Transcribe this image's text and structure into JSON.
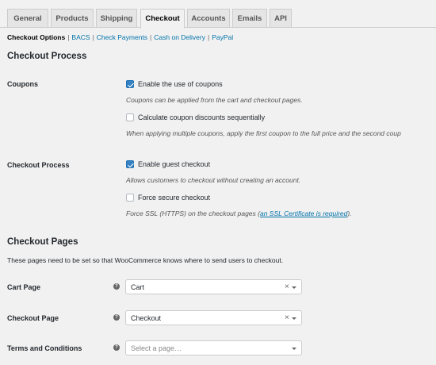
{
  "tabs": [
    "General",
    "Products",
    "Shipping",
    "Checkout",
    "Accounts",
    "Emails",
    "API"
  ],
  "subnav": {
    "current": "Checkout Options",
    "links": [
      "BACS",
      "Check Payments",
      "Cash on Delivery",
      "PayPal"
    ],
    "separator": "|"
  },
  "checkout_process": {
    "heading": "Checkout Process",
    "coupons": {
      "label": "Coupons",
      "enable_label": "Enable the use of coupons",
      "enable_checked": true,
      "enable_desc": "Coupons can be applied from the cart and checkout pages.",
      "sequential_label": "Calculate coupon discounts sequentially",
      "sequential_checked": false,
      "sequential_desc": "When applying multiple coupons, apply the first coupon to the full price and the second coup"
    },
    "process": {
      "label": "Checkout Process",
      "guest_label": "Enable guest checkout",
      "guest_checked": true,
      "guest_desc": "Allows customers to checkout without creating an account.",
      "secure_label": "Force secure checkout",
      "secure_checked": false,
      "secure_desc_prefix": "Force SSL (HTTPS) on the checkout pages (",
      "secure_desc_link": "an SSL Certificate is required",
      "secure_desc_suffix": ")."
    }
  },
  "checkout_pages": {
    "heading": "Checkout Pages",
    "intro": "These pages need to be set so that WooCommerce knows where to send users to checkout.",
    "help_glyph": "?",
    "cart": {
      "label": "Cart Page",
      "value": "Cart",
      "clear": "×"
    },
    "checkout": {
      "label": "Checkout Page",
      "value": "Checkout",
      "clear": "×"
    },
    "terms": {
      "label": "Terms and Conditions",
      "placeholder": "Select a page…"
    }
  }
}
